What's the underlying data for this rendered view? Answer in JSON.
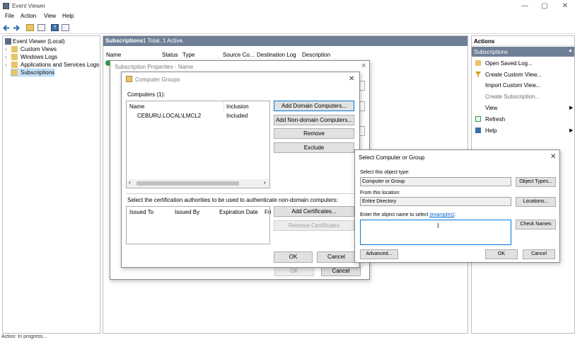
{
  "window": {
    "title": "Event Viewer",
    "minimize": "—",
    "maximize": "▢",
    "close": "✕"
  },
  "menu": [
    "File",
    "Action",
    "View",
    "Help"
  ],
  "tree": {
    "root": "Event Viewer (Local)",
    "items": [
      "Custom Views",
      "Windows Logs",
      "Applications and Services Logs",
      "Subscriptions"
    ]
  },
  "center": {
    "header_title": "Subscriptions",
    "header_count": "1 Total, 1 Active.",
    "columns": [
      "Name",
      "Status",
      "Type",
      "Source Co...",
      "Destination Log",
      "Description"
    ]
  },
  "actions": {
    "header": "Actions",
    "section": "Subscriptions",
    "items": [
      "Open Saved Log...",
      "Create Custom View...",
      "Import Custom View...",
      "Create Subscription...",
      "View",
      "Refresh",
      "Help"
    ]
  },
  "status": "Action: In progress...",
  "subscription_properties": {
    "title": "Subscription Properties - Name",
    "ok": "OK",
    "cancel": "Cancel"
  },
  "computer_groups": {
    "title": "Computer Groups",
    "computers_label": "Computers (1):",
    "columns": [
      "Name",
      "Inclusion"
    ],
    "rows": [
      {
        "name": "CEBURU.LOCAL\\LMCL2",
        "inclusion": "Included"
      }
    ],
    "add_domain": "Add Domain Computers...",
    "add_nondomain": "Add Non-domain Computers...",
    "remove": "Remove",
    "exclude": "Exclude",
    "cert_label": "Select the certification authorities to be used to authenticate non-domain computers:",
    "cert_columns": [
      "Issued To",
      "Issued By",
      "Expiration Date",
      "Fri"
    ],
    "add_certs": "Add Certificates...",
    "remove_certs": "Remove Certificates",
    "ok": "OK",
    "cancel": "Cancel"
  },
  "select_dialog": {
    "title": "Select Computer or Group",
    "object_type_label": "Select this object type:",
    "object_type_value": "Computer or Group",
    "object_types_btn": "Object Types...",
    "location_label": "From this location:",
    "location_value": "Entire Directory",
    "locations_btn": "Locations...",
    "enter_label": "Enter the object name to select",
    "examples": "(examples)",
    "enter_colon": ":",
    "check_names": "Check Names",
    "advanced": "Advanced...",
    "ok": "OK",
    "cancel": "Cancel",
    "name_value": ""
  },
  "colors": {
    "header_bg": "#6f7f96",
    "accent": "#0078d7",
    "link": "#0066cc"
  }
}
